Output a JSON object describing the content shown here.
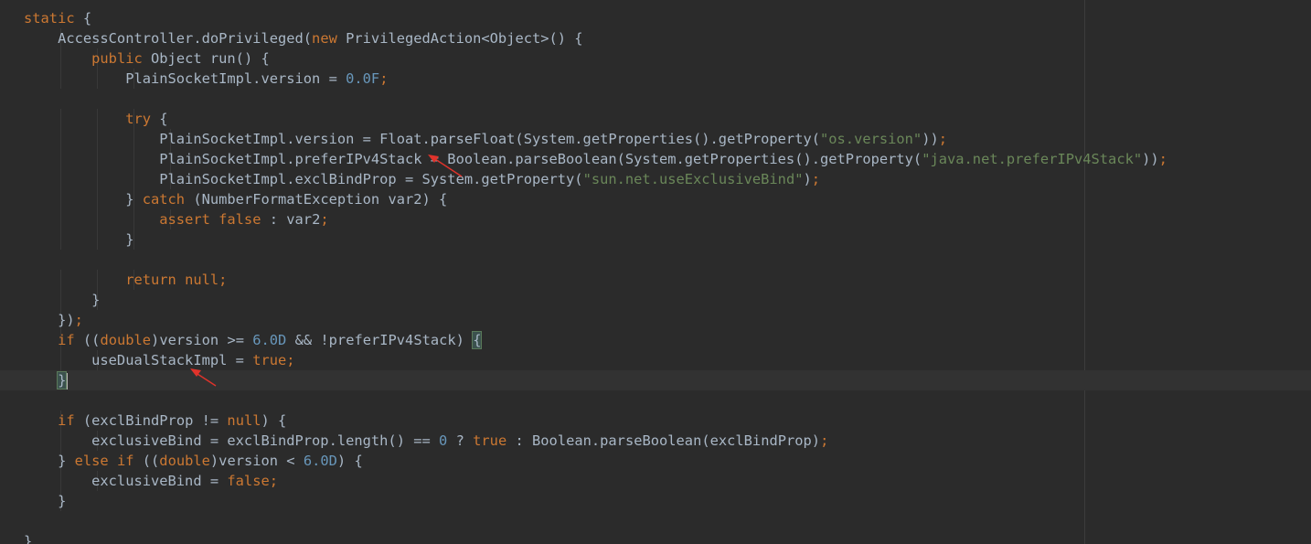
{
  "editor": {
    "lines": [
      {
        "id": "l1",
        "tokens": [
          {
            "t": "static",
            "c": "k"
          },
          {
            "t": " {",
            "c": "p"
          }
        ]
      },
      {
        "id": "l2",
        "tokens": [
          {
            "t": "    AccessController.doPrivileged(",
            "c": "p"
          },
          {
            "t": "new",
            "c": "k"
          },
          {
            "t": " PrivilegedAction<Object>() {",
            "c": "p"
          }
        ]
      },
      {
        "id": "l3",
        "tokens": [
          {
            "t": "        ",
            "c": "p"
          },
          {
            "t": "public",
            "c": "k"
          },
          {
            "t": " Object run() {",
            "c": "p"
          }
        ]
      },
      {
        "id": "l4",
        "tokens": [
          {
            "t": "            PlainSocketImpl.version = ",
            "c": "p"
          },
          {
            "t": "0.0F",
            "c": "n"
          },
          {
            "t": ";",
            "c": "k"
          }
        ]
      },
      {
        "id": "l5",
        "tokens": []
      },
      {
        "id": "l6",
        "tokens": [
          {
            "t": "            ",
            "c": "p"
          },
          {
            "t": "try",
            "c": "k"
          },
          {
            "t": " {",
            "c": "p"
          }
        ]
      },
      {
        "id": "l7",
        "tokens": [
          {
            "t": "                PlainSocketImpl.version = Float.parseFloat(System.getProperties().getProperty(",
            "c": "p"
          },
          {
            "t": "\"os.version\"",
            "c": "s"
          },
          {
            "t": "))",
            "c": "p"
          },
          {
            "t": ";",
            "c": "k"
          }
        ]
      },
      {
        "id": "l8",
        "tokens": [
          {
            "t": "                PlainSocketImpl.preferIPv4Stack = Boolean.parseBoolean(System.getProperties().getProperty(",
            "c": "p"
          },
          {
            "t": "\"java.net.preferIPv4Stack\"",
            "c": "s"
          },
          {
            "t": "))",
            "c": "p"
          },
          {
            "t": ";",
            "c": "k"
          }
        ]
      },
      {
        "id": "l9",
        "tokens": [
          {
            "t": "                PlainSocketImpl.exclBindProp = System.getProperty(",
            "c": "p"
          },
          {
            "t": "\"sun.net.useExclusiveBind\"",
            "c": "s"
          },
          {
            "t": ")",
            "c": "p"
          },
          {
            "t": ";",
            "c": "k"
          }
        ]
      },
      {
        "id": "l10",
        "tokens": [
          {
            "t": "            } ",
            "c": "p"
          },
          {
            "t": "catch",
            "c": "k"
          },
          {
            "t": " (NumberFormatException var2) {",
            "c": "p"
          }
        ]
      },
      {
        "id": "l11",
        "tokens": [
          {
            "t": "                ",
            "c": "p"
          },
          {
            "t": "assert false",
            "c": "k"
          },
          {
            "t": " : var2",
            "c": "p"
          },
          {
            "t": ";",
            "c": "k"
          }
        ]
      },
      {
        "id": "l12",
        "tokens": [
          {
            "t": "            }",
            "c": "p"
          }
        ]
      },
      {
        "id": "l13",
        "tokens": []
      },
      {
        "id": "l14",
        "tokens": [
          {
            "t": "            ",
            "c": "p"
          },
          {
            "t": "return null;",
            "c": "k"
          }
        ]
      },
      {
        "id": "l15",
        "tokens": [
          {
            "t": "        }",
            "c": "p"
          }
        ]
      },
      {
        "id": "l16",
        "tokens": [
          {
            "t": "    })",
            "c": "p"
          },
          {
            "t": ";",
            "c": "k"
          }
        ]
      },
      {
        "id": "l17",
        "tokens": [
          {
            "t": "    ",
            "c": "p"
          },
          {
            "t": "if",
            "c": "k"
          },
          {
            "t": " ((",
            "c": "p"
          },
          {
            "t": "double",
            "c": "k"
          },
          {
            "t": ")version >= ",
            "c": "p"
          },
          {
            "t": "6.0D",
            "c": "n"
          },
          {
            "t": " && !preferIPv4Stack) ",
            "c": "p"
          },
          {
            "t": "{",
            "c": "bm"
          }
        ]
      },
      {
        "id": "l18",
        "tokens": [
          {
            "t": "        useDualStackImpl = ",
            "c": "p"
          },
          {
            "t": "true;",
            "c": "k"
          }
        ]
      },
      {
        "id": "l19",
        "tokens": [
          {
            "t": "    ",
            "c": "p"
          },
          {
            "t": "}",
            "c": "bm"
          },
          {
            "t": "",
            "c": "caret"
          }
        ]
      },
      {
        "id": "l20",
        "tokens": []
      },
      {
        "id": "l21",
        "tokens": [
          {
            "t": "    ",
            "c": "p"
          },
          {
            "t": "if",
            "c": "k"
          },
          {
            "t": " (exclBindProp != ",
            "c": "p"
          },
          {
            "t": "null",
            "c": "k"
          },
          {
            "t": ") {",
            "c": "p"
          }
        ]
      },
      {
        "id": "l22",
        "tokens": [
          {
            "t": "        exclusiveBind = exclBindProp.length() == ",
            "c": "p"
          },
          {
            "t": "0",
            "c": "n"
          },
          {
            "t": " ? ",
            "c": "p"
          },
          {
            "t": "true",
            "c": "k"
          },
          {
            "t": " : Boolean.parseBoolean(exclBindProp)",
            "c": "p"
          },
          {
            "t": ";",
            "c": "k"
          }
        ]
      },
      {
        "id": "l23",
        "tokens": [
          {
            "t": "    } ",
            "c": "p"
          },
          {
            "t": "else if",
            "c": "k"
          },
          {
            "t": " ((",
            "c": "p"
          },
          {
            "t": "double",
            "c": "k"
          },
          {
            "t": ")version < ",
            "c": "p"
          },
          {
            "t": "6.0D",
            "c": "n"
          },
          {
            "t": ") {",
            "c": "p"
          }
        ]
      },
      {
        "id": "l24",
        "tokens": [
          {
            "t": "        exclusiveBind = ",
            "c": "p"
          },
          {
            "t": "false;",
            "c": "k"
          }
        ]
      },
      {
        "id": "l25",
        "tokens": [
          {
            "t": "    }",
            "c": "p"
          }
        ]
      },
      {
        "id": "l26",
        "tokens": []
      },
      {
        "id": "l27",
        "tokens": [
          {
            "t": "}",
            "c": "p"
          }
        ]
      }
    ],
    "current_line": 19
  },
  "colors": {
    "background": "#2b2b2b",
    "keyword": "#cc7832",
    "string": "#6a8759",
    "number": "#6897bb",
    "plain": "#a9b7c6",
    "annotation_arrow": "#e0332b"
  }
}
